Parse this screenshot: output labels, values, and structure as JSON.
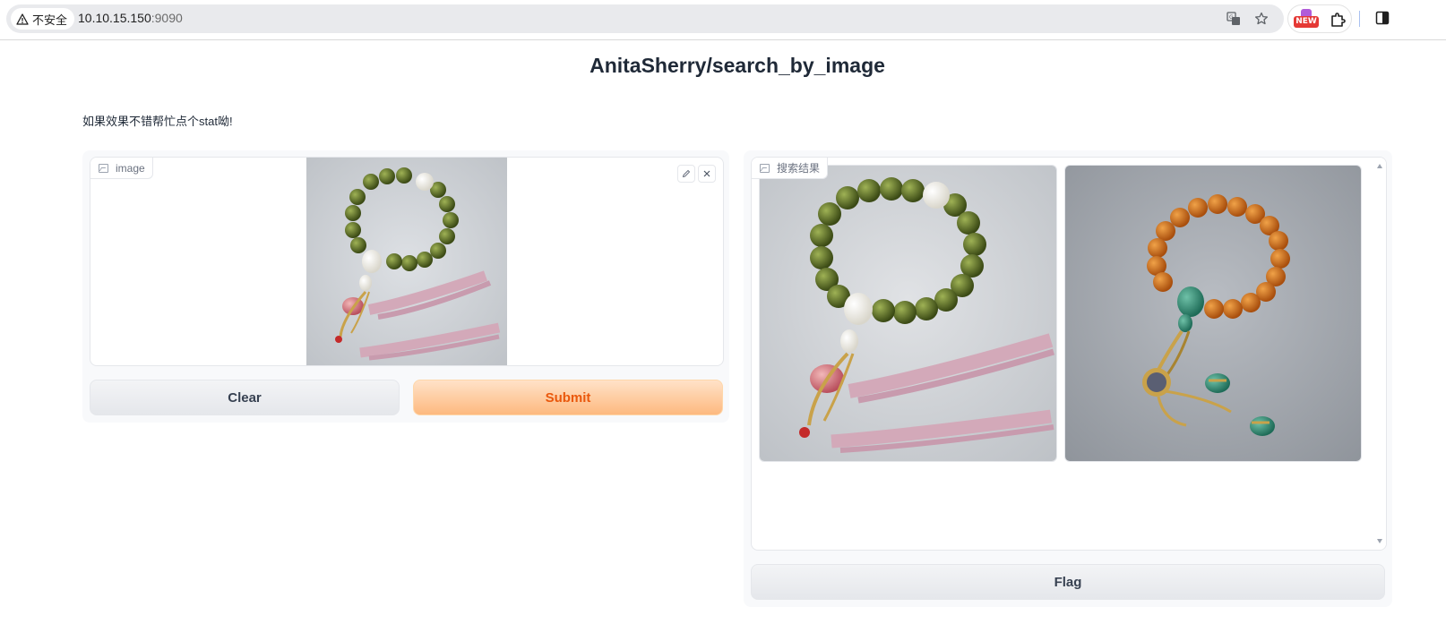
{
  "browser": {
    "security_label": "不安全",
    "url_host": "10.10.15.150",
    "url_port": ":9090",
    "extension_badge": "NEW"
  },
  "page": {
    "title": "AnitaSherry/search_by_image",
    "description": "如果效果不错帮忙点个stat呦!"
  },
  "input": {
    "label": "image",
    "image_subject": "green bead bracelet with white gourd bead and pink tassels"
  },
  "buttons": {
    "clear": "Clear",
    "submit": "Submit",
    "flag": "Flag"
  },
  "output": {
    "label": "搜索结果",
    "results": [
      {
        "subject": "green bead bracelet with pink tassels"
      },
      {
        "subject": "amber bead bracelet with green gourd and pendants"
      }
    ]
  },
  "colors": {
    "accent": "#ea580c",
    "primary_button": "#fdb97f"
  }
}
